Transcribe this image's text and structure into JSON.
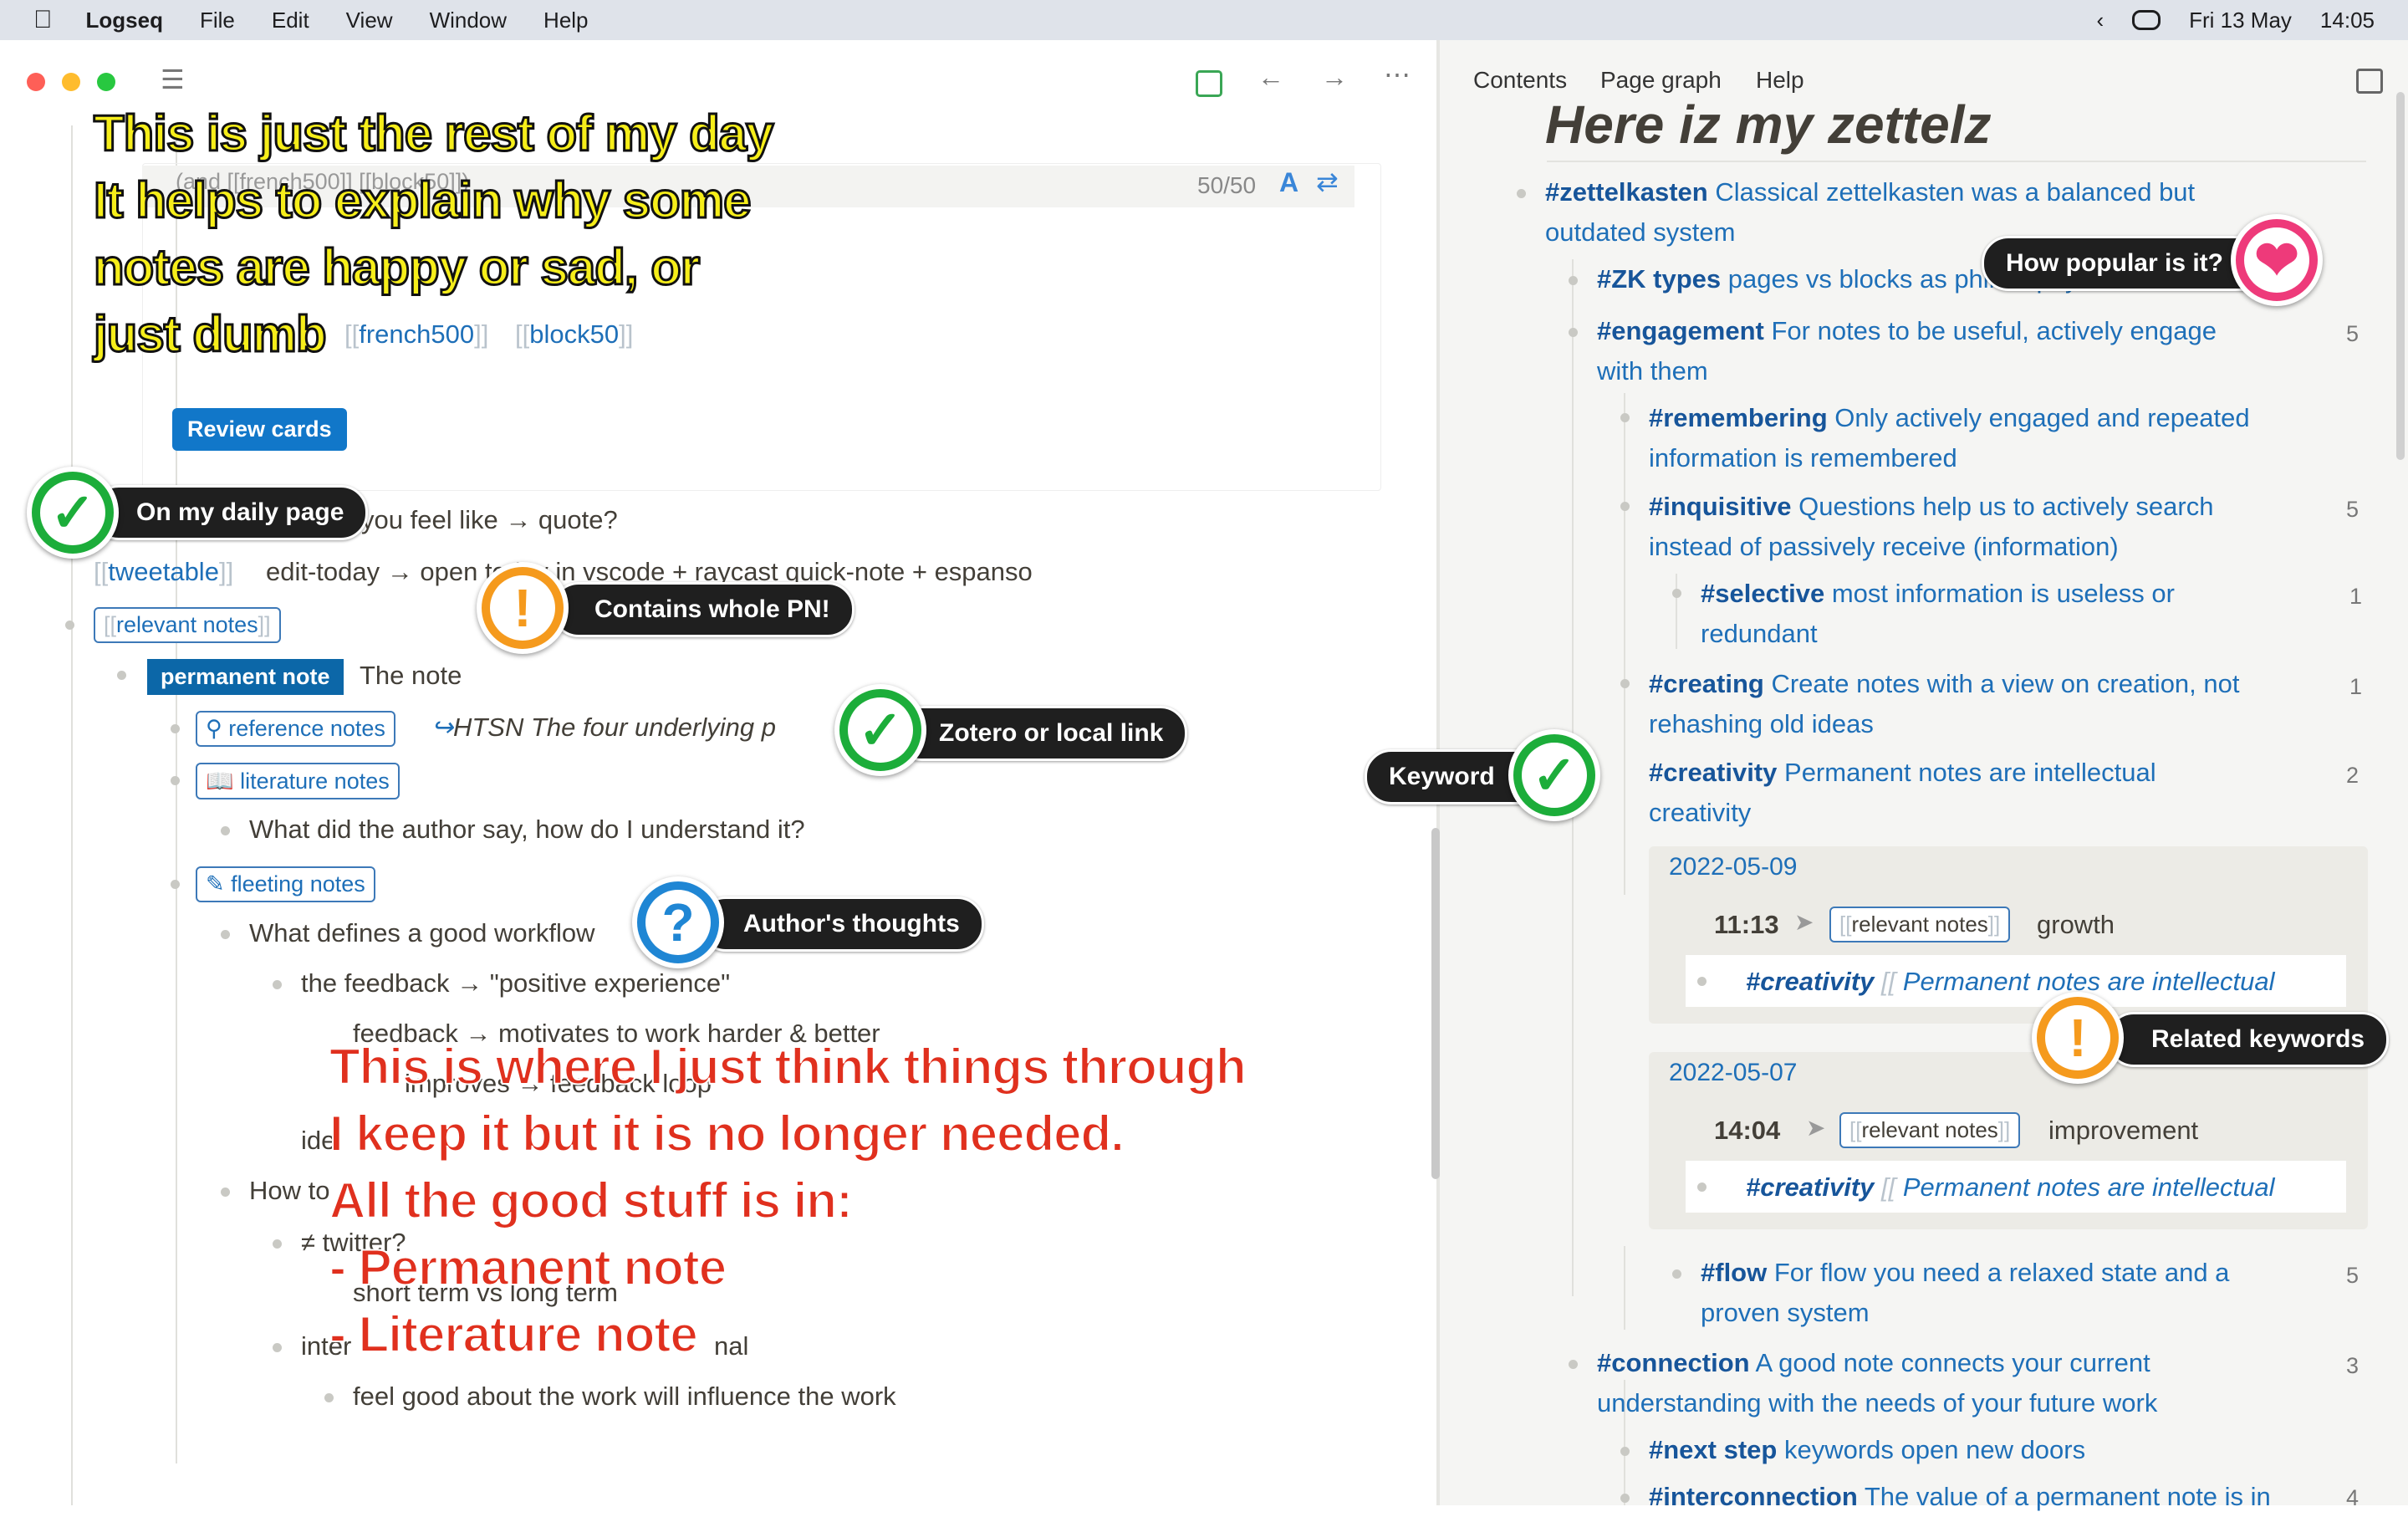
{
  "menubar": {
    "app": "Logseq",
    "items": [
      "File",
      "Edit",
      "View",
      "Window",
      "Help"
    ],
    "date": "Fri 13 May",
    "time": "14:05"
  },
  "right_tabs": [
    "Contents",
    "Page graph",
    "Help"
  ],
  "left": {
    "count": "50/50",
    "query_text": "(and [[french500]] [[block50]])",
    "tag_french": "french500",
    "tag_block": "block50",
    "review_button": "Review cards",
    "line_quote": "you feel like → quote?",
    "tweetable": "tweetable",
    "line_edit": "edit-today → open today in vscode + raycast quick-note + espanso",
    "relevant_notes": "relevant notes",
    "permanent_note": "permanent note",
    "the_note": "The note",
    "reference_notes": "reference notes",
    "htsn": "HTSN The four underlying p",
    "literature_notes": "literature notes",
    "author_q": "What did the author say, how do I understand it?",
    "fleeting_notes": "fleeting notes",
    "workflow": "What defines a good workflow",
    "feedback": "the feedback → \"positive experience\"",
    "feedback2": "feedback → motivates to work harder & better",
    "improves": "improves → feedback loop",
    "ide": "ide",
    "how_to": "How to",
    "twitter": "≠ twitter?",
    "short_term": "short term vs long term",
    "inter": "inter",
    "nal": "nal",
    "feel_good": "feel good about the work will influence the work"
  },
  "right": {
    "page_title": "Here iz my zettelz",
    "items": [
      {
        "tag": "#zettelkasten",
        "text": "Classical zettelkasten was a balanced but",
        "text2": "outdated system",
        "count": ""
      },
      {
        "tag": "#ZK types",
        "text": "pages vs blocks as philosophy",
        "text2": "",
        "count": ""
      },
      {
        "tag": "#engagement",
        "text": "For notes to be useful, actively engage",
        "text2": "with them",
        "count": "5"
      },
      {
        "tag": "#remembering",
        "text": "Only actively engaged and repeated",
        "text2": "information is remembered",
        "count": ""
      },
      {
        "tag": "#inquisitive",
        "text": "Questions help us to actively search",
        "text2": "instead of passively receive (information)",
        "count": "5"
      },
      {
        "tag": "#selective",
        "text": "most information is useless or",
        "text2": "redundant",
        "count": "1"
      },
      {
        "tag": "#creating",
        "text": "Create notes with a view on creation, not",
        "text2": "rehashing old ideas",
        "count": "1"
      },
      {
        "tag": "#creativity",
        "text": "Permanent notes are intellectual",
        "text2": "creativity",
        "count": "2"
      },
      {
        "tag": "#flow",
        "text": "For flow you need a relaxed state and a",
        "text2": "proven system",
        "count": "5"
      },
      {
        "tag": "#connection",
        "text": "A good note connects your current",
        "text2": "understanding with the needs of your future work",
        "count": "3"
      },
      {
        "tag": "#next step",
        "text": "keywords open new doors",
        "text2": "",
        "count": ""
      },
      {
        "tag": "#interconnection",
        "text": "The value of a permanent note is in",
        "text2": "",
        "count": "4"
      }
    ],
    "refs": [
      {
        "date": "2022-05-09",
        "time": "11:13",
        "tag": "relevant notes",
        "word": "growth",
        "cre": "#creativity",
        "link": "Permanent notes are intellectual"
      },
      {
        "date": "2022-05-07",
        "time": "14:04",
        "tag": "relevant notes",
        "word": "improvement",
        "cre": "#creativity",
        "link": "Permanent notes are intellectual"
      }
    ]
  },
  "callouts": {
    "daily": "On my daily page",
    "whole_pn": "Contains whole PN!",
    "zotero": "Zotero or local link",
    "authors": "Author's thoughts",
    "keyword": "Keyword",
    "popular": "How popular is it?",
    "related": "Related keywords"
  },
  "overlay_yellow": [
    "This is just the rest of my day",
    "It helps to explain why some",
    "notes are happy or sad, or",
    "just dumb"
  ],
  "overlay_red": [
    "This is where I just think things through",
    "I keep it but it is no longer needed.",
    "All the good stuff is in:",
    "- Permanent note",
    "- Literature note"
  ]
}
